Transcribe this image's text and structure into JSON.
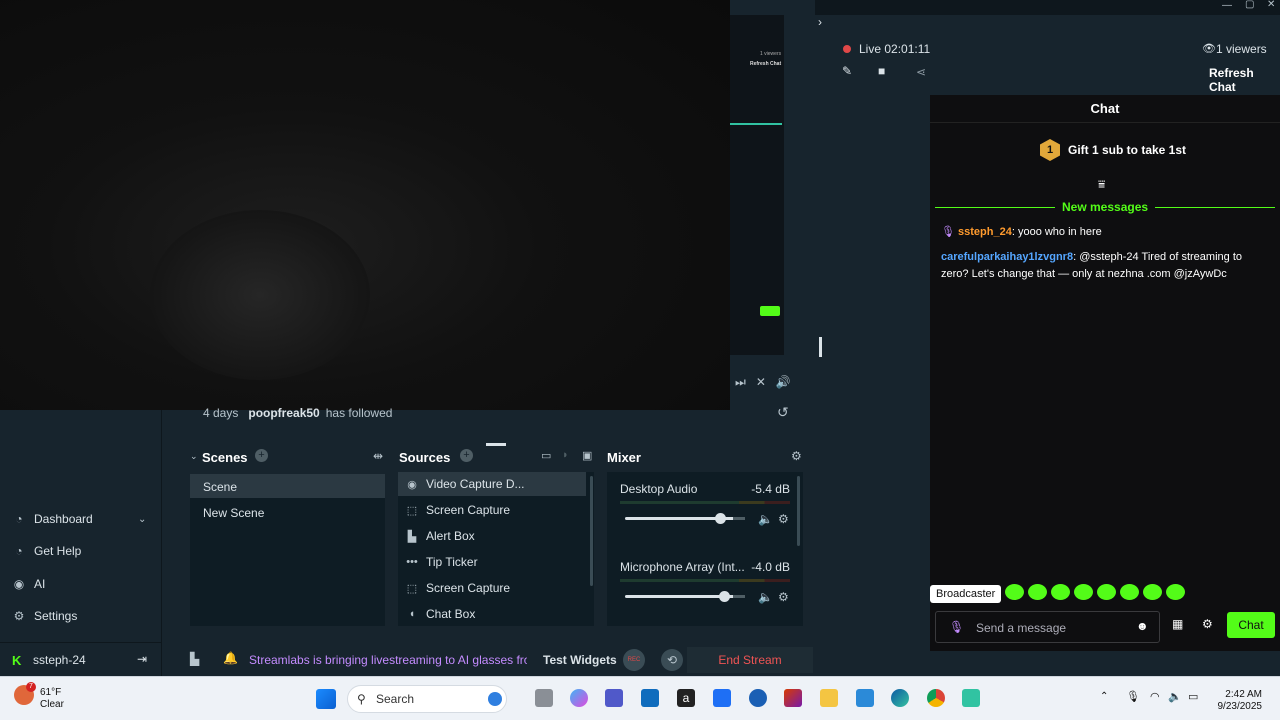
{
  "video": {
    "activity_time": "4 days",
    "activity_user": "poopfreak50",
    "activity_text": "has followed"
  },
  "mini_preview": {
    "viewers": "1 viewers",
    "refresh": "Refresh Chat",
    "chat": "Chat"
  },
  "sidebar": {
    "items": [
      {
        "label": "Dashboard",
        "icon": "dashboard-icon",
        "has_chevron": true
      },
      {
        "label": "Get Help",
        "icon": "help-icon"
      },
      {
        "label": "AI",
        "icon": "ai-icon"
      },
      {
        "label": "Settings",
        "icon": "gear-icon"
      }
    ],
    "user": "ssteph-24"
  },
  "scenes": {
    "title": "Scenes",
    "items": [
      "Scene",
      "New Scene"
    ]
  },
  "sources": {
    "title": "Sources",
    "items": [
      {
        "label": "Video Capture D...",
        "icon": "webcam-icon"
      },
      {
        "label": "Screen Capture",
        "icon": "screen-capture-icon"
      },
      {
        "label": "Alert Box",
        "icon": "alert-box-icon"
      },
      {
        "label": "Tip Ticker",
        "icon": "ticker-icon"
      },
      {
        "label": "Screen Capture",
        "icon": "screen-capture-icon"
      },
      {
        "label": "Chat Box",
        "icon": "chat-box-icon"
      }
    ]
  },
  "mixer": {
    "title": "Mixer",
    "channels": [
      {
        "name": "Desktop Audio",
        "db": "-5.4 dB",
        "level": 0.86
      },
      {
        "name": "Microphone Array (Int...",
        "db": "-4.0 dB",
        "level": 0.9
      }
    ]
  },
  "bottombar": {
    "ticker": "Streamlabs is bringing livestreaming to AI glasses from",
    "test_widgets": "Test Widgets",
    "rec": "REC",
    "end_stream": "End Stream"
  },
  "stream": {
    "status": "Live",
    "time": "02:01:11",
    "viewers": "1 viewers",
    "refresh": "Refresh Chat"
  },
  "chat": {
    "title": "Chat",
    "gift_rank": "1",
    "gift_text": "Gift 1 sub to take 1st",
    "new_messages": "New messages",
    "messages": [
      {
        "user": "ssteph_24",
        "text": ": yooo who in here"
      },
      {
        "user": "carefulparkaihay1lzvgnr8",
        "text": ": @ssteph-24 Tired of streaming to zero? Let's change that — only at nezhna .com @jzAywDc"
      }
    ],
    "tooltip": "Broadcaster",
    "input_placeholder": "Send a message",
    "send": "Chat"
  },
  "taskbar": {
    "weather_temp": "61°F",
    "weather_cond": "Clear",
    "weather_badge": "7",
    "search": "Search",
    "time": "2:42 AM",
    "date": "9/23/2025"
  },
  "colors": {
    "accent_green": "#53fc18",
    "live_red": "#e04848",
    "end_stream_red": "#f05454",
    "ticker_purple": "#c48cff"
  }
}
